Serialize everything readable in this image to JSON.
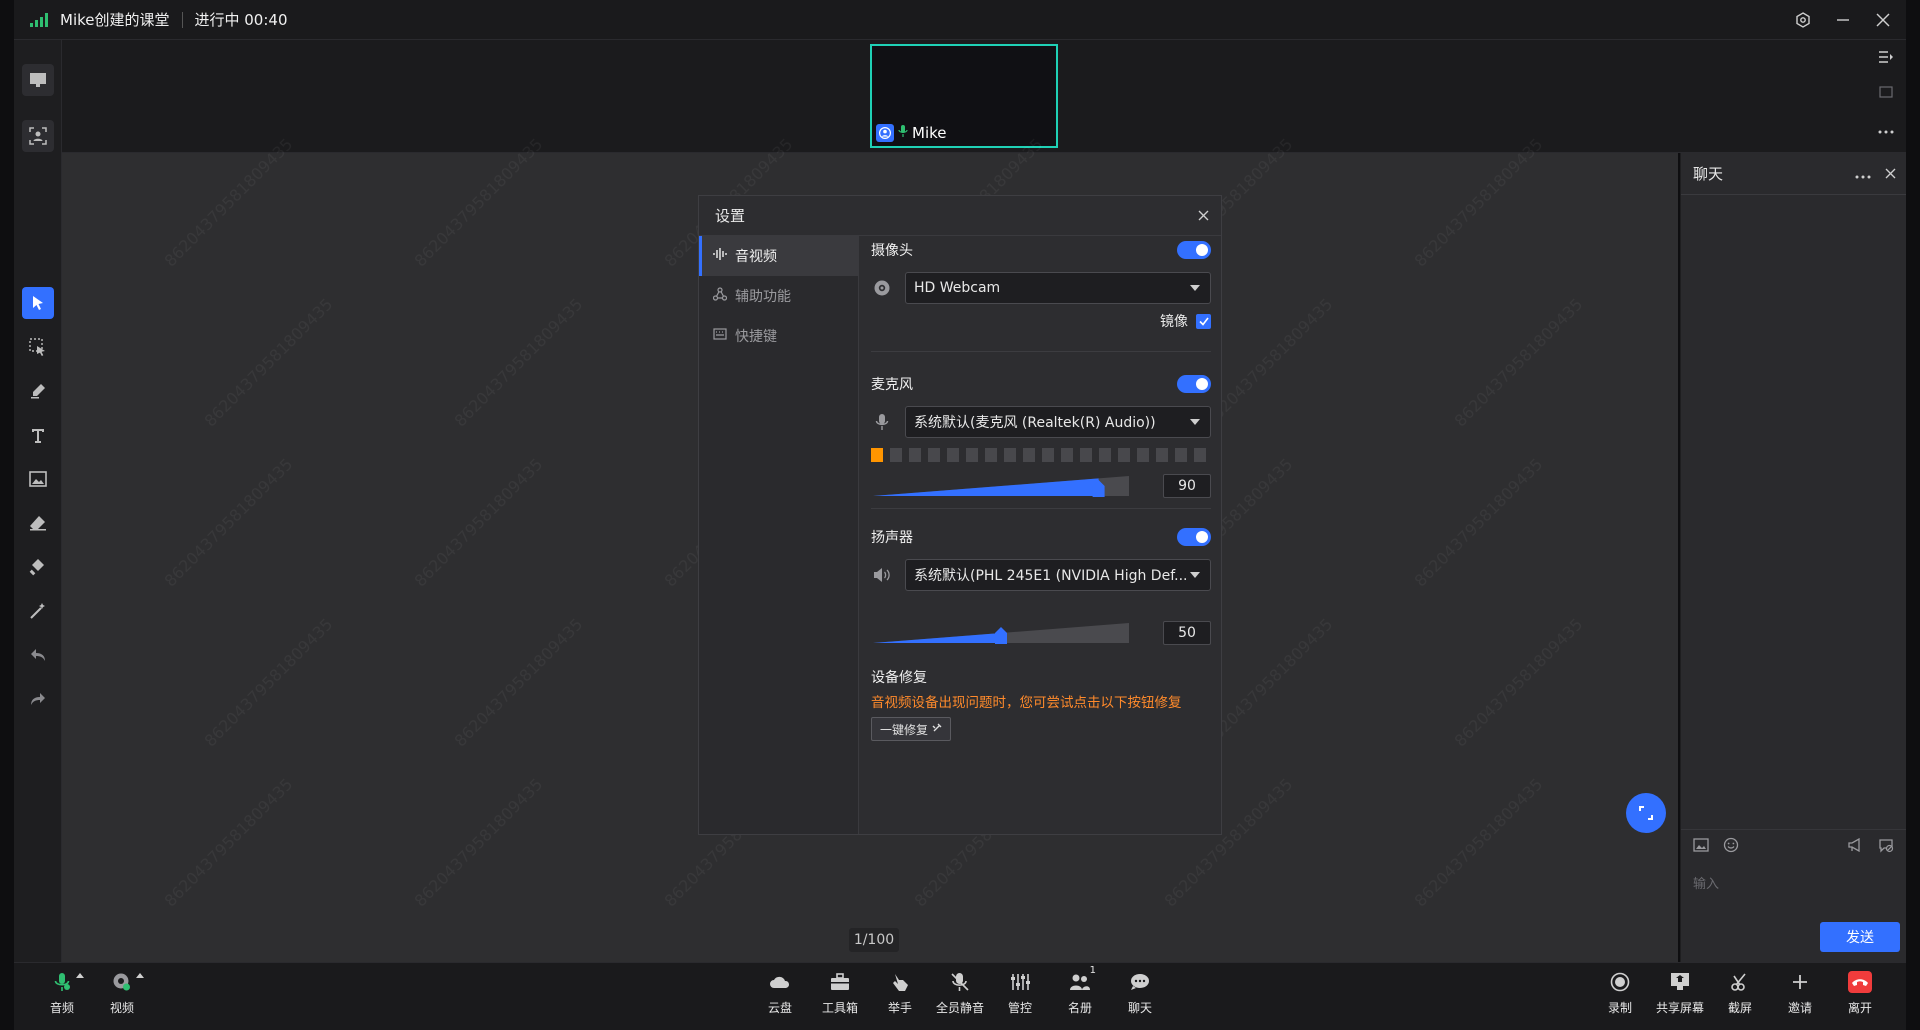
{
  "titlebar": {
    "title": "Mike创建的课堂",
    "status": "进行中 00:40",
    "icons": [
      "settings-hex-icon",
      "minimize-icon",
      "close-icon"
    ]
  },
  "video": {
    "participant_name": "Mike",
    "active_border_color": "#1fd1b6"
  },
  "board": {
    "page_indicator": "1/100",
    "watermark_text": "8620437958180943​5"
  },
  "dialog": {
    "title": "设置",
    "nav": [
      {
        "label": "音视频",
        "icon": "audio-wave-icon",
        "active": true
      },
      {
        "label": "辅助功能",
        "icon": "accessibility-icon",
        "active": false
      },
      {
        "label": "快捷键",
        "icon": "keyboard-icon",
        "active": false
      }
    ],
    "camera": {
      "label": "摄像头",
      "enabled": true,
      "device": "HD Webcam",
      "mirror_label": "镜像",
      "mirror_checked": true
    },
    "microphone": {
      "label": "麦克风",
      "enabled": true,
      "device": "系统默认(麦克风 (Realtek(R) Audio))",
      "level_segments_on": 1,
      "level_segments_total": 18,
      "volume": "90",
      "volume_fraction": 0.9
    },
    "speaker": {
      "label": "扬声器",
      "enabled": true,
      "device": "系统默认(PHL 245E1 (NVIDIA High Def...",
      "volume": "50",
      "volume_fraction": 0.5
    },
    "repair": {
      "label": "设备修复",
      "hint": "音视频设备出现问题时，您可尝试点击以下按钮修复",
      "button": "一键修复"
    }
  },
  "chat": {
    "title": "聊天",
    "input_placeholder": "输入",
    "send_label": "发送"
  },
  "toolbar": {
    "left": [
      {
        "label": "音频",
        "icon": "microphone-icon"
      },
      {
        "label": "视频",
        "icon": "camera-icon"
      }
    ],
    "center": [
      {
        "label": "云盘",
        "icon": "cloud-icon"
      },
      {
        "label": "工具箱",
        "icon": "toolbox-icon"
      },
      {
        "label": "举手",
        "icon": "raise-hand-icon"
      },
      {
        "label": "全员静音",
        "icon": "mute-all-icon"
      },
      {
        "label": "管控",
        "icon": "control-sliders-icon"
      },
      {
        "label": "名册",
        "icon": "roster-icon",
        "badge": "1"
      },
      {
        "label": "聊天",
        "icon": "chat-bubble-icon"
      }
    ],
    "right": [
      {
        "label": "录制",
        "icon": "record-icon"
      },
      {
        "label": "共享屏幕",
        "icon": "share-screen-icon"
      },
      {
        "label": "截屏",
        "icon": "screenshot-icon"
      },
      {
        "label": "邀请",
        "icon": "plus-icon"
      },
      {
        "label": "离开",
        "icon": "hangup-icon"
      }
    ]
  },
  "colors": {
    "accent": "#3370ff",
    "warning": "#ff9500",
    "leave": "#f03c3c",
    "hint": "#ff8a2b"
  }
}
